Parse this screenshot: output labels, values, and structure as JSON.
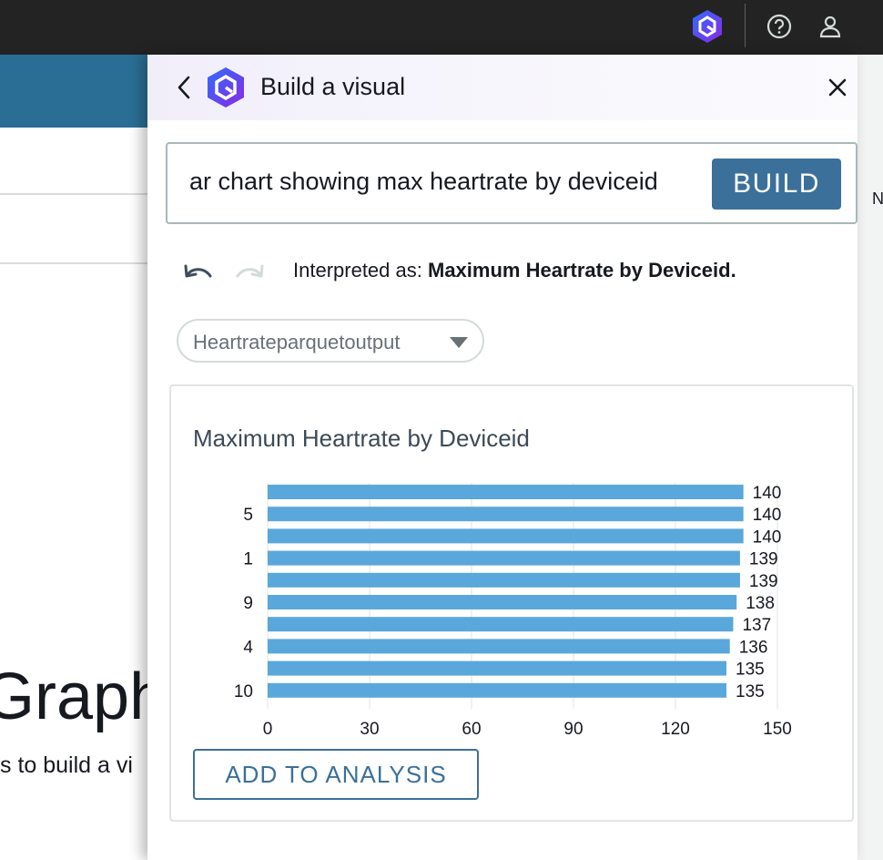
{
  "topbar": {
    "icons": [
      "amazon-q-icon",
      "help-icon",
      "user-icon"
    ],
    "accent_color": "#5a3cd6"
  },
  "background": {
    "heading_fragment": "Graph",
    "subtext_fragment": "s to build a vi",
    "right_edge_fragment": "N"
  },
  "panel": {
    "title": "Build a visual",
    "query_value": "ar chart showing max heartrate by deviceid",
    "build_label": "BUILD",
    "interpreted_prefix": "Interpreted as:",
    "interpreted_value": "Maximum Heartrate by Deviceid.",
    "dataset": "Heartrateparquetoutput",
    "add_to_analysis_label": "ADD TO ANALYSIS",
    "primary_color": "#3a709a"
  },
  "chart_data": {
    "type": "bar",
    "orientation": "horizontal",
    "title": "Maximum Heartrate by Deviceid",
    "y_tick_labels": [
      "",
      "5",
      "",
      "1",
      "",
      "9",
      "",
      "4",
      "",
      "10"
    ],
    "values": [
      140,
      140,
      140,
      139,
      139,
      138,
      137,
      136,
      135,
      135
    ],
    "data_labels": [
      "140",
      "140",
      "140",
      "139",
      "139",
      "138",
      "137",
      "136",
      "135",
      "135"
    ],
    "x_ticks": [
      0,
      30,
      60,
      90,
      120,
      150
    ],
    "xlim": [
      0,
      150
    ],
    "grid": true,
    "bar_color": "#5aa7dc"
  }
}
